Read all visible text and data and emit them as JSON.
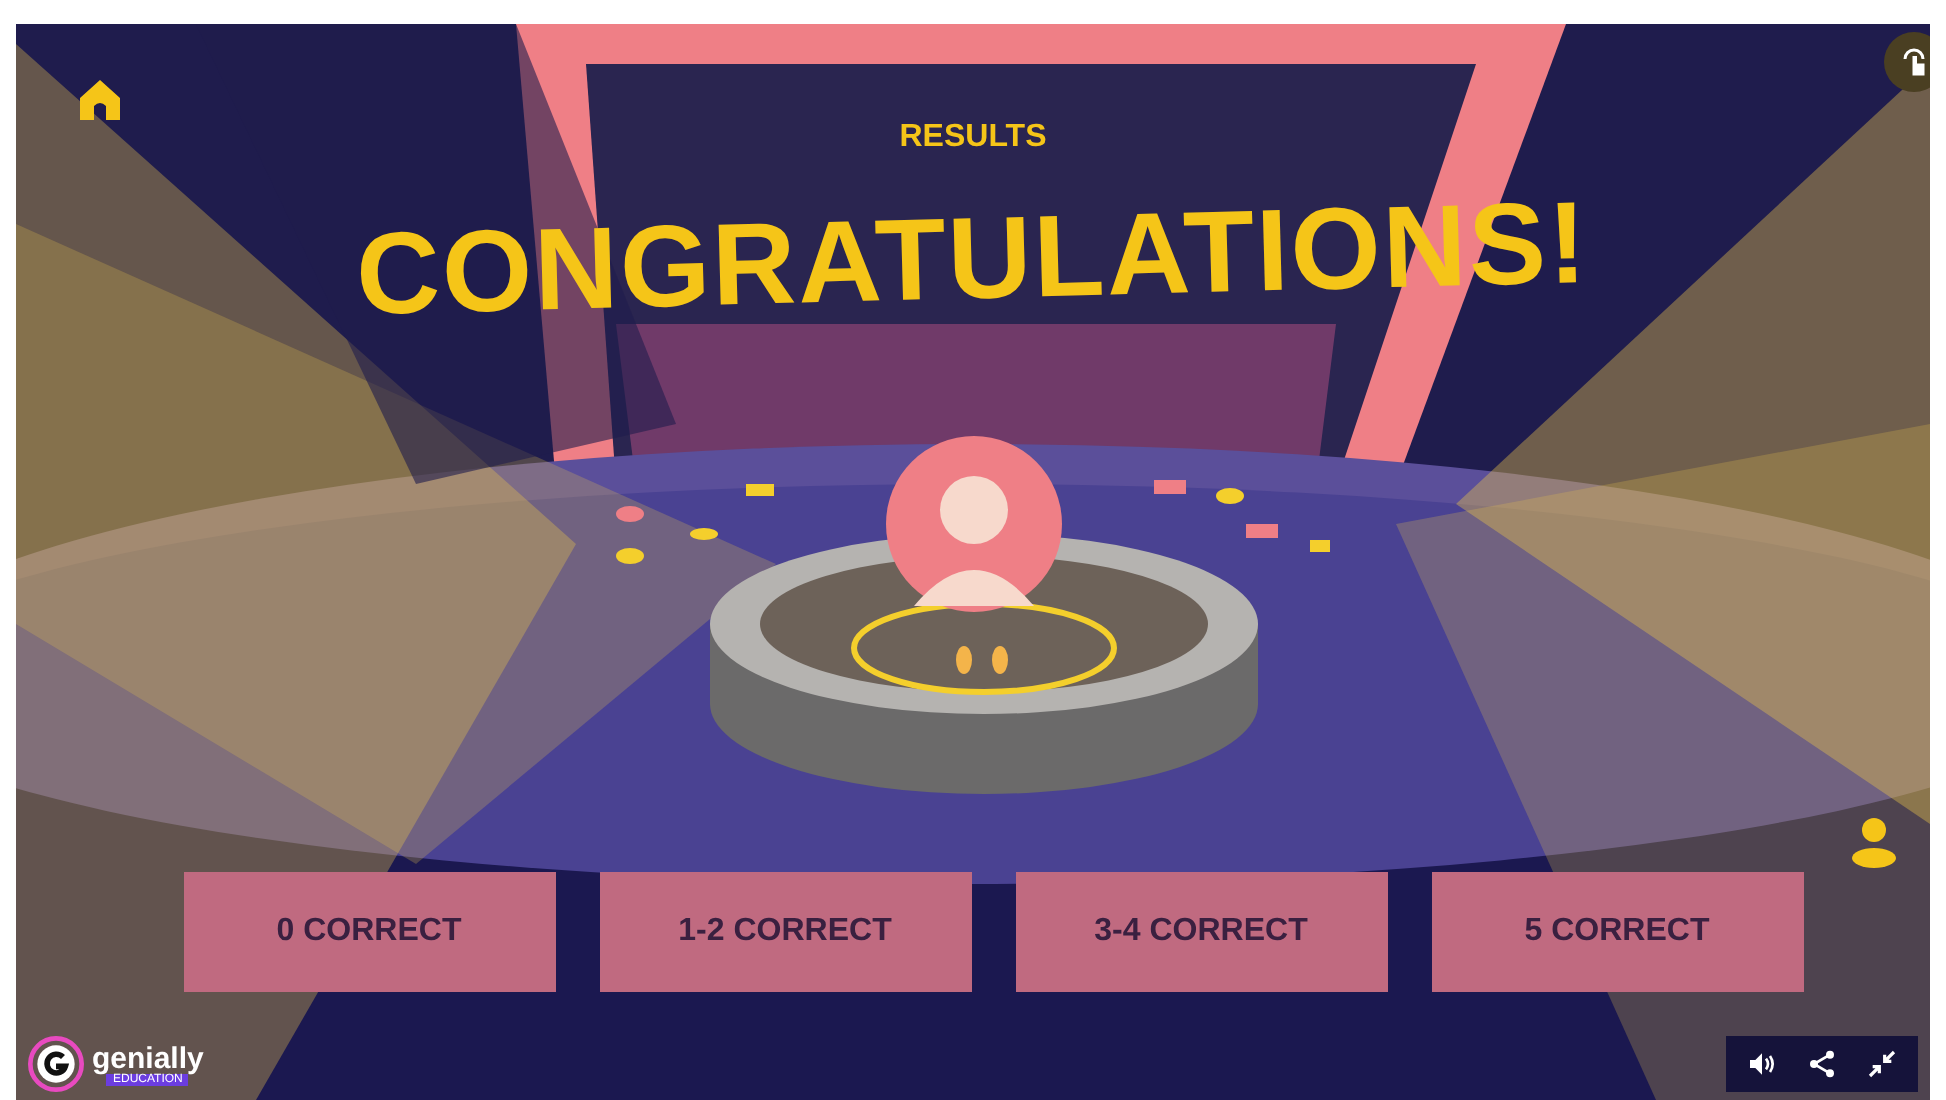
{
  "header": {
    "subtitle": "RESULTS",
    "title": "CONGRATULATIONS!"
  },
  "options": [
    {
      "label": "0 CORRECT"
    },
    {
      "label": "1-2 CORRECT"
    },
    {
      "label": "3-4 CORRECT"
    },
    {
      "label": "5 CORRECT"
    }
  ],
  "logo": {
    "name": "genially",
    "tag": "EDUCATION"
  }
}
